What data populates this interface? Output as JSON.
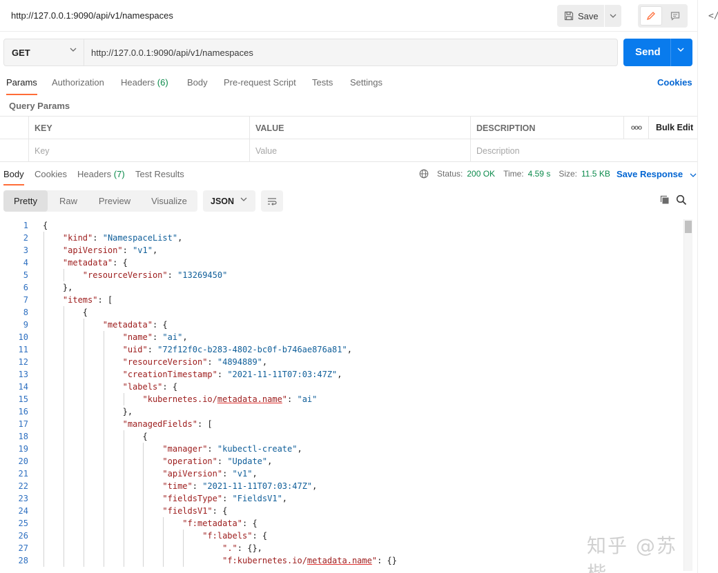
{
  "titlebar": {
    "title": "http://127.0.0.1:9090/api/v1/namespaces",
    "save_label": "Save"
  },
  "request": {
    "method": "GET",
    "url": "http://127.0.0.1:9090/api/v1/namespaces",
    "send_label": "Send"
  },
  "req_tabs": [
    {
      "label": "Params",
      "active": true
    },
    {
      "label": "Authorization"
    },
    {
      "label": "Headers",
      "count": "(6)"
    },
    {
      "label": "Body"
    },
    {
      "label": "Pre-request Script"
    },
    {
      "label": "Tests"
    },
    {
      "label": "Settings"
    }
  ],
  "cookies_label": "Cookies",
  "query_params": {
    "title": "Query Params",
    "headers": [
      "KEY",
      "VALUE",
      "DESCRIPTION"
    ],
    "bulk_edit": "Bulk Edit",
    "more": "ooo",
    "placeholders": [
      "Key",
      "Value",
      "Description"
    ]
  },
  "res_tabs": [
    {
      "label": "Body",
      "active": true
    },
    {
      "label": "Cookies"
    },
    {
      "label": "Headers",
      "count": "(7)"
    },
    {
      "label": "Test Results"
    }
  ],
  "status": {
    "status_label": "Status:",
    "status_value": "200 OK",
    "time_label": "Time:",
    "time_value": "4.59 s",
    "size_label": "Size:",
    "size_value": "11.5 KB"
  },
  "save_response": "Save Response",
  "format": {
    "modes": [
      "Pretty",
      "Raw",
      "Preview",
      "Visualize"
    ],
    "active": "Pretty",
    "language": "JSON"
  },
  "code_lines": [
    "{",
    "    \"kind\": \"NamespaceList\",",
    "    \"apiVersion\": \"v1\",",
    "    \"metadata\": {",
    "        \"resourceVersion\": \"13269450\"",
    "    },",
    "    \"items\": [",
    "        {",
    "            \"metadata\": {",
    "                \"name\": \"ai\",",
    "                \"uid\": \"72f12f0c-b283-4802-bc0f-b746ae876a81\",",
    "                \"resourceVersion\": \"4894889\",",
    "                \"creationTimestamp\": \"2021-11-11T07:03:47Z\",",
    "                \"labels\": {",
    "                    \"kubernetes.io/metadata.name\": \"ai\"",
    "                },",
    "                \"managedFields\": [",
    "                    {",
    "                        \"manager\": \"kubectl-create\",",
    "                        \"operation\": \"Update\",",
    "                        \"apiVersion\": \"v1\",",
    "                        \"time\": \"2021-11-11T07:03:47Z\",",
    "                        \"fieldsType\": \"FieldsV1\",",
    "                        \"fieldsV1\": {",
    "                            \"f:metadata\": {",
    "                                \"f:labels\": {",
    "                                    \".\": {},",
    "                                    \"f:kubernetes.io/metadata.name\": {}"
  ],
  "watermark": "知乎 @苏楷",
  "sidebar_code_icon": "</>",
  "colors": {
    "accent": "#ff6c37",
    "send": "#097bed",
    "link": "#0265d2",
    "status_ok": "#0b8a4b"
  }
}
